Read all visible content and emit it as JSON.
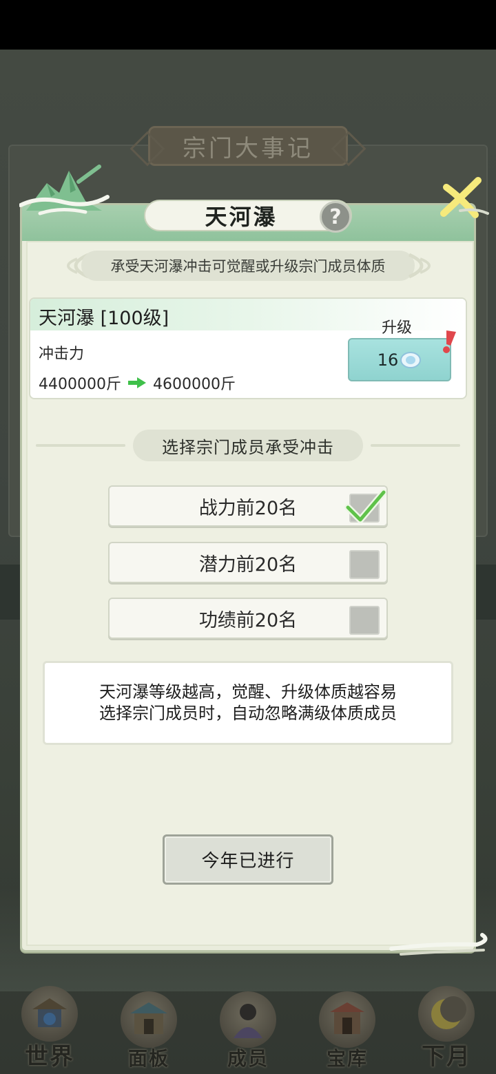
{
  "background": {
    "header_title": "宗门大事记"
  },
  "modal": {
    "title": "天河瀑",
    "help_symbol": "?",
    "subtitle": "承受天河瀑冲击可觉醒或升级宗门成员体质",
    "info": {
      "name_level": "天河瀑 [100级]",
      "attribute_label": "冲击力",
      "current_value": "4400000斤",
      "next_value": "4600000斤"
    },
    "upgrade": {
      "label": "升级",
      "cost": "16",
      "cost_icon": "spirit-gem-icon"
    },
    "section_title": "选择宗门成员承受冲击",
    "options": [
      {
        "label": "战力前20名",
        "checked": true
      },
      {
        "label": "潜力前20名",
        "checked": false
      },
      {
        "label": "功绩前20名",
        "checked": false
      }
    ],
    "notes": [
      "天河瀑等级越高，觉醒、升级体质越容易",
      "选择宗门成员时，自动忽略满级体质成员"
    ],
    "action_button": "今年已进行"
  },
  "bottom_nav": [
    {
      "label": "世界",
      "icon": "world-temple-icon"
    },
    {
      "label": "面板",
      "icon": "panel-hall-icon"
    },
    {
      "label": "成员",
      "icon": "member-portrait-icon"
    },
    {
      "label": "宝库",
      "icon": "treasury-gate-icon"
    },
    {
      "label": "下月",
      "icon": "crescent-moon-icon"
    }
  ],
  "colors": {
    "accent_green": "#8fc29c",
    "check_green": "#5fc24a",
    "upgrade_teal": "#8fd3cf",
    "alert_red": "#e0474c"
  }
}
